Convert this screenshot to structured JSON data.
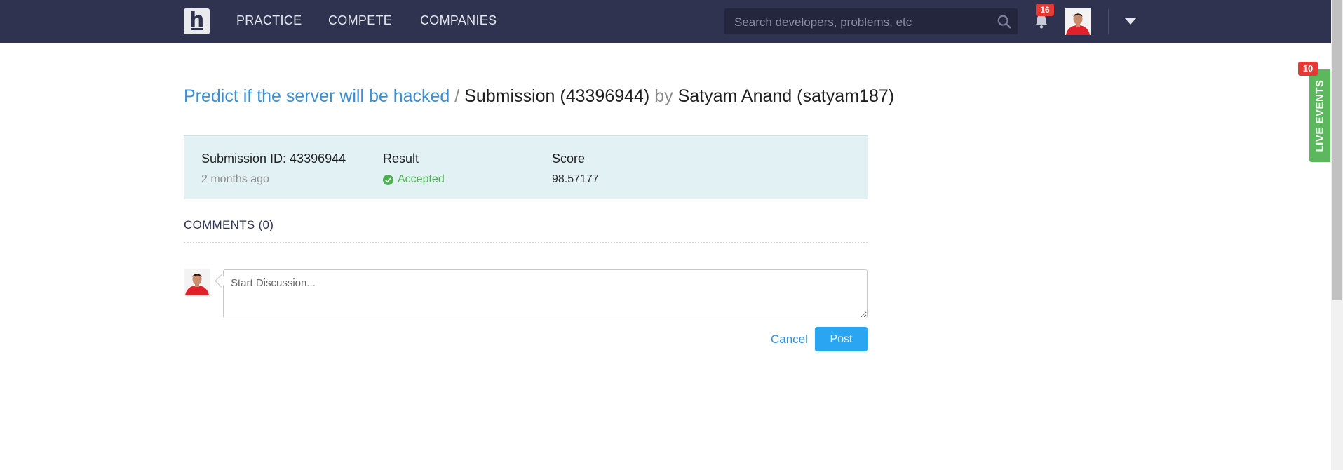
{
  "nav": {
    "logo_letter": "h",
    "items": [
      "PRACTICE",
      "COMPETE",
      "COMPANIES"
    ],
    "search_placeholder": "Search developers, problems, etc",
    "notifications_count": "16",
    "icons": [
      "search-icon",
      "bell-icon",
      "caret-down-icon"
    ]
  },
  "breadcrumb": {
    "problem": "Predict if the server will be hacked",
    "separator": "/",
    "submission": "Submission (43396944)",
    "by": "by",
    "user": "Satyam Anand (satyam187)"
  },
  "submission": {
    "id_label": "Submission ID: 43396944",
    "time_ago": "2 months ago",
    "result_label": "Result",
    "result_value": "Accepted",
    "score_label": "Score",
    "score_value": "98.57177"
  },
  "comments": {
    "heading": "COMMENTS (0)",
    "placeholder": "Start Discussion...",
    "cancel_label": "Cancel",
    "post_label": "Post"
  },
  "live_events": {
    "label": "LIVE EVENTS",
    "count": "10"
  },
  "colors": {
    "navbar": "#2f3350",
    "link": "#3a8fd6",
    "accepted": "#4caf50",
    "post_button": "#2aa5f2",
    "live_tab": "#5cb85c",
    "badge": "#e53935",
    "info_box": "#e1f1f4"
  }
}
